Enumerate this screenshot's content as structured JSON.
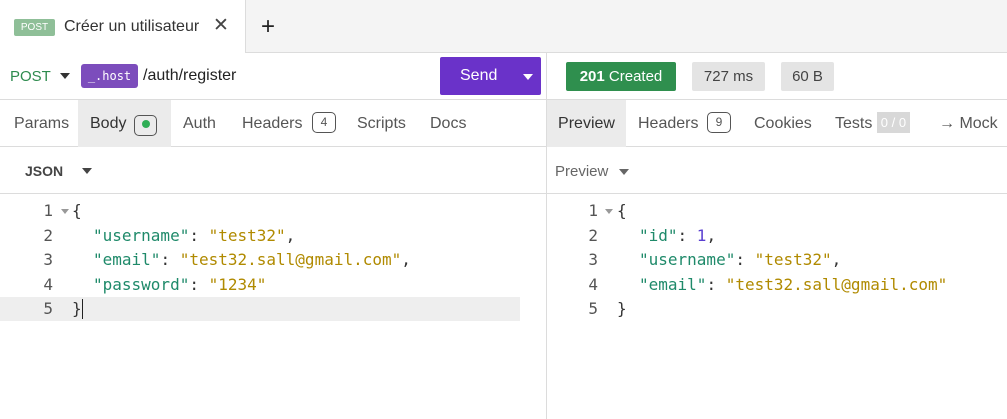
{
  "tab": {
    "method": "POST",
    "title": "Créer un utilisateur",
    "close": "✕",
    "add": "+"
  },
  "request": {
    "method": "POST",
    "host_var": "_.host",
    "path": "/auth/register",
    "send": "Send"
  },
  "response": {
    "status_code": "201",
    "status_text": "Created",
    "time": "727 ms",
    "size": "60 B"
  },
  "request_tabs": {
    "params": "Params",
    "body": "Body",
    "auth": "Auth",
    "headers": "Headers",
    "headers_count": "4",
    "scripts": "Scripts",
    "docs": "Docs"
  },
  "response_tabs": {
    "preview": "Preview",
    "headers": "Headers",
    "headers_count": "9",
    "cookies": "Cookies",
    "tests": "Tests",
    "tests_count": "0 / 0",
    "mock": "→ Mock"
  },
  "request_format": "JSON",
  "response_format": "Preview",
  "request_body": {
    "line_numbers": [
      "1",
      "2",
      "3",
      "4",
      "5"
    ],
    "open": "{",
    "close": "}",
    "fields": [
      {
        "key": "\"username\"",
        "value": "\"test32\"",
        "sep": ": ",
        "end": ","
      },
      {
        "key": "\"email\"",
        "value": "\"test32.sall@gmail.com\"",
        "sep": ": ",
        "end": ","
      },
      {
        "key": "\"password\"",
        "value": "\"1234\"",
        "sep": ": ",
        "end": ""
      }
    ]
  },
  "response_body": {
    "line_numbers": [
      "1",
      "2",
      "3",
      "4",
      "5"
    ],
    "open": "{",
    "close": "}",
    "fields": [
      {
        "key": "\"id\"",
        "value": "1",
        "sep": ": ",
        "end": ","
      },
      {
        "key": "\"username\"",
        "value": "\"test32\"",
        "sep": ": ",
        "end": ","
      },
      {
        "key": "\"email\"",
        "value": "\"test32.sall@gmail.com\"",
        "sep": ": ",
        "end": ""
      }
    ]
  },
  "colors": {
    "accent": "#6a32c9",
    "method_green": "#2e8b4e",
    "status_green": "#2f8f4e",
    "json_key": "#1f8a6a",
    "json_string": "#b08a00",
    "json_number": "#5a3fd0"
  },
  "icons": {
    "close": "close-icon",
    "add": "plus-icon",
    "dropdown": "chevron-down-icon",
    "fold": "fold-arrow-icon",
    "status_dot": "status-dot-icon"
  }
}
